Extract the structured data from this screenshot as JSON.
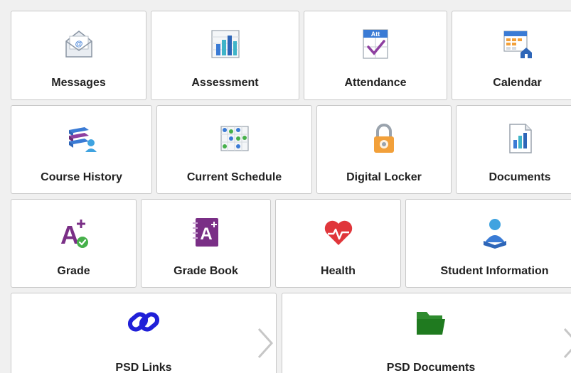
{
  "tiles": {
    "messages": {
      "label": "Messages",
      "icon": "mail-icon"
    },
    "assessment": {
      "label": "Assessment",
      "icon": "bar-chart-icon"
    },
    "attendance": {
      "label": "Attendance",
      "icon": "attendance-icon",
      "badge": "Att"
    },
    "calendar": {
      "label": "Calendar",
      "icon": "calendar-icon"
    },
    "course_history": {
      "label": "Course History",
      "icon": "books-icon"
    },
    "current_schedule": {
      "label": "Current Schedule",
      "icon": "schedule-icon"
    },
    "digital_locker": {
      "label": "Digital Locker",
      "icon": "lock-icon"
    },
    "documents": {
      "label": "Documents",
      "icon": "document-chart-icon"
    },
    "grade": {
      "label": "Grade",
      "icon": "grade-icon",
      "glyph": "A"
    },
    "grade_book": {
      "label": "Grade Book",
      "icon": "grade-book-icon",
      "glyph": "A"
    },
    "health": {
      "label": "Health",
      "icon": "heart-pulse-icon"
    },
    "student_information": {
      "label": "Student Information",
      "icon": "student-icon"
    },
    "psd_links": {
      "label": "PSD Links",
      "icon": "link-icon"
    },
    "psd_documents": {
      "label": "PSD Documents",
      "icon": "folder-icon"
    }
  },
  "colors": {
    "accent_blue": "#3a7bd5",
    "grade_purple": "#7a2f86",
    "health_red": "#e0363b",
    "link_blue": "#2020d8",
    "folder_green": "#1f7a1f",
    "lock_orange": "#f2a03a"
  }
}
